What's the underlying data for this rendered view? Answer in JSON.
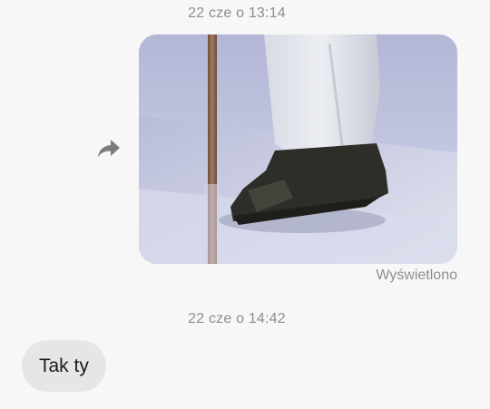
{
  "conversation": {
    "messages": [
      {
        "timestamp": "22 cze o 13:14",
        "type": "image",
        "direction": "outgoing",
        "status": "Wyświetlono"
      },
      {
        "timestamp": "22 cze o 14:42",
        "type": "text",
        "direction": "incoming",
        "text": "Tak ty"
      }
    ]
  },
  "icons": {
    "forward": "share-arrow-icon"
  },
  "colors": {
    "background": "#f7f7f7",
    "incoming_bubble": "#e6e6e6",
    "meta_text": "#8e8e8e"
  }
}
